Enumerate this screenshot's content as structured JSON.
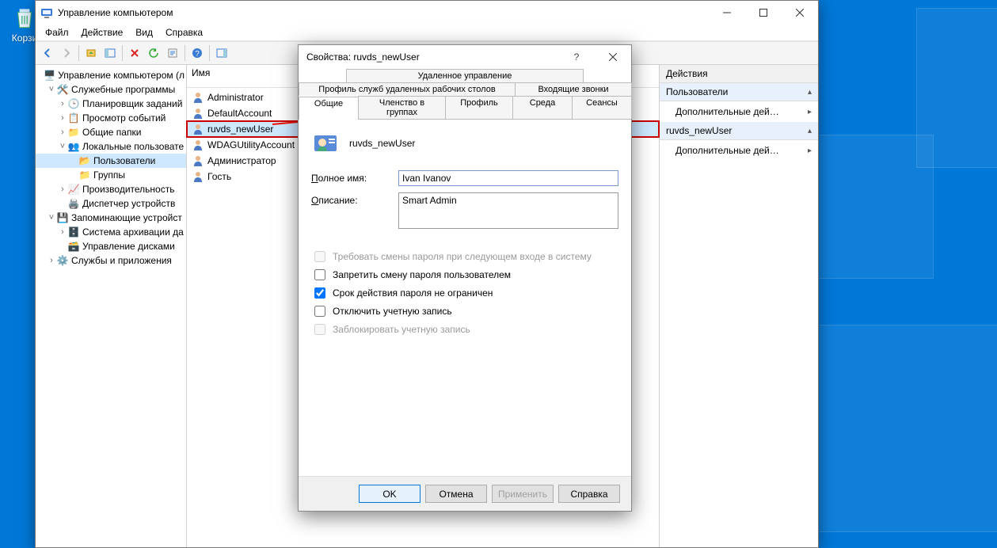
{
  "desktop": {
    "recycle_bin": "Корзи"
  },
  "mmc": {
    "title": "Управление компьютером",
    "menu": [
      "Файл",
      "Действие",
      "Вид",
      "Справка"
    ],
    "tree": {
      "root": "Управление компьютером (л",
      "services_root": "Служебные программы",
      "scheduler": "Планировщик заданий",
      "events": "Просмотр событий",
      "shared": "Общие папки",
      "local_users": "Локальные пользовате",
      "users": "Пользователи",
      "groups": "Группы",
      "perf": "Производительность",
      "devmgr": "Диспетчер устройств",
      "storage_root": "Запоминающие устройст",
      "backup": "Система архивации да",
      "disks": "Управление дисками",
      "svcapps": "Службы и приложения"
    },
    "list": {
      "col": "Имя",
      "items": [
        "Administrator",
        "DefaultAccount",
        "ruvds_newUser",
        "WDAGUtilityAccount",
        "Администратор",
        "Гость"
      ],
      "selected_index": 2
    },
    "actions": {
      "header": "Действия",
      "section1": "Пользователи",
      "link1": "Дополнительные дей…",
      "section2": "ruvds_newUser",
      "link2": "Дополнительные дей…"
    }
  },
  "dialog": {
    "title": "Свойства: ruvds_newUser",
    "tabs_row1": [
      "Удаленное управление"
    ],
    "tabs_row2": [
      "Профиль служб удаленных рабочих столов",
      "Входящие звонки"
    ],
    "tabs_row3": [
      "Общие",
      "Членство в группах",
      "Профиль",
      "Среда",
      "Сеансы"
    ],
    "active_tab": "Общие",
    "username": "ruvds_newUser",
    "labels": {
      "fullname": "Полное имя:",
      "desc": "Описание:"
    },
    "fields": {
      "fullname": "Ivan Ivanov",
      "desc": "Smart Admin"
    },
    "checks": {
      "must_change": "Требовать смены пароля при следующем входе в систему",
      "cannot_change": "Запретить смену пароля пользователем",
      "never_expires": "Срок действия пароля не ограничен",
      "disabled": "Отключить учетную запись",
      "locked": "Заблокировать учетную запись"
    },
    "buttons": {
      "ok": "OK",
      "cancel": "Отмена",
      "apply": "Применить",
      "help": "Справка"
    }
  }
}
